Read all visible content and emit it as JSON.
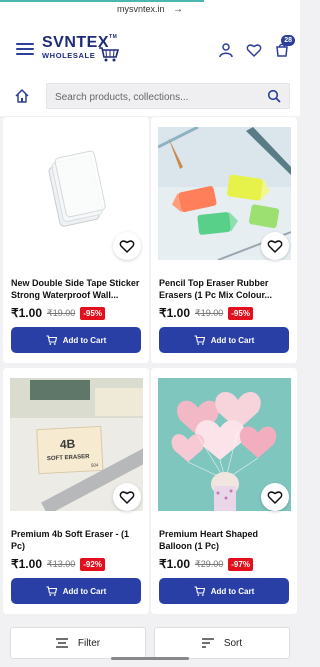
{
  "browser": {
    "url": "mysvntex.in",
    "forward_icon": "arrow-right-icon"
  },
  "header": {
    "logo_brand": "SVNTEX",
    "logo_tm": "TM",
    "logo_sub": "WHOLESALE",
    "cart_count": "28",
    "brand_color": "#1f2a7a"
  },
  "search": {
    "placeholder": "Search products, collections..."
  },
  "products": [
    {
      "title": "New Double Side Tape Sticker Strong Waterproof Wall...",
      "price": "₹1.00",
      "mrp": "₹19.00",
      "discount": "-95%",
      "add_label": "Add to Cart"
    },
    {
      "title": "Pencil Top Eraser Rubber Erasers (1 Pc Mix Colour...",
      "price": "₹1.00",
      "mrp": "₹19.00",
      "discount": "-95%",
      "add_label": "Add to Cart"
    },
    {
      "title": "Premium 4b Soft Eraser - (1 Pc)",
      "price": "₹1.00",
      "mrp": "₹13.00",
      "discount": "-92%",
      "add_label": "Add to Cart"
    },
    {
      "title": "Premium Heart Shaped Balloon (1 Pc)",
      "price": "₹1.00",
      "mrp": "₹29.00",
      "discount": "-97%",
      "add_label": "Add to Cart"
    }
  ],
  "image_text": {
    "eraser_line1": "4B",
    "eraser_line2": "SOFT ERASER",
    "eraser_code": "504"
  },
  "bottom": {
    "filter_label": "Filter",
    "sort_label": "Sort"
  },
  "colors": {
    "accent": "#2a3fa6",
    "discount": "#e30f1c"
  }
}
